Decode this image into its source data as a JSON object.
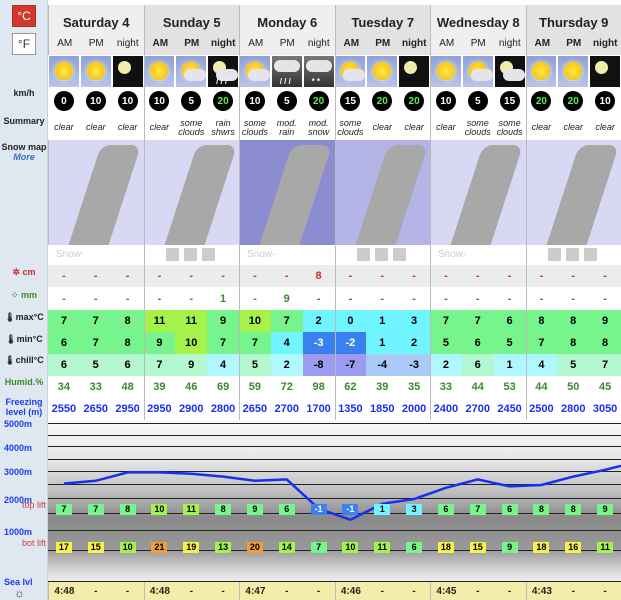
{
  "units": {
    "celsius": "°C",
    "fahrenheit": "°F"
  },
  "labels": {
    "wind": "km/h",
    "summary": "Summary",
    "snow_map": "Snow map",
    "more": "More",
    "snow_cm": "cm",
    "rain_mm": "mm",
    "max": "max°C",
    "min": "min°C",
    "chill": "chill°C",
    "humid": "Humid.%",
    "freezing": "Freezing level (m)",
    "alt5000": "5000m",
    "alt4000": "4000m",
    "alt3000": "3000m",
    "alt2000": "2000m",
    "alt1000": "1000m",
    "sea": "Sea lvl",
    "top_lift": "top lift",
    "bot_lift": "bot lift"
  },
  "days": [
    {
      "name": "Saturday 4"
    },
    {
      "name": "Sunday 5"
    },
    {
      "name": "Monday 6"
    },
    {
      "name": "Tuesday 7"
    },
    {
      "name": "Wednesday 8"
    },
    {
      "name": "Thursday 9"
    }
  ],
  "periods": [
    "AM",
    "PM",
    "night"
  ],
  "map_credit": "Snow-Forecast.com",
  "icons": [
    "sun",
    "sun",
    "moon",
    "sun",
    "sun-cloud",
    "moon-rain",
    "sun-cloud",
    "rain",
    "snow",
    "sun-cloud",
    "sun",
    "moon",
    "sun",
    "sun-cloud",
    "moon-cloud",
    "sun",
    "sun",
    "moon"
  ],
  "wind": [
    "0",
    "10",
    "10",
    "10",
    "5",
    "20",
    "10",
    "5",
    "20",
    "15",
    "20",
    "20",
    "10",
    "5",
    "15",
    "20",
    "20",
    "10"
  ],
  "summary": [
    "clear",
    "clear",
    "clear",
    "clear",
    "some clouds",
    "rain shwrs",
    "some clouds",
    "mod. rain",
    "mod. snow",
    "some clouds",
    "clear",
    "clear",
    "clear",
    "some clouds",
    "some clouds",
    "clear",
    "clear",
    "clear"
  ],
  "snow_cm": [
    "-",
    "-",
    "-",
    "-",
    "-",
    "-",
    "-",
    "-",
    "8",
    "-",
    "-",
    "-",
    "-",
    "-",
    "-",
    "-",
    "-",
    "-"
  ],
  "rain_mm": [
    "-",
    "-",
    "-",
    "-",
    "-",
    "1",
    "-",
    "9",
    "-",
    "-",
    "-",
    "-",
    "-",
    "-",
    "-",
    "-",
    "-",
    "-"
  ],
  "max": [
    "7",
    "7",
    "8",
    "11",
    "11",
    "9",
    "10",
    "7",
    "2",
    "0",
    "1",
    "3",
    "7",
    "7",
    "6",
    "8",
    "8",
    "9"
  ],
  "min": [
    "6",
    "7",
    "8",
    "9",
    "10",
    "7",
    "7",
    "4",
    "-3",
    "-2",
    "1",
    "2",
    "5",
    "6",
    "5",
    "7",
    "8",
    "8"
  ],
  "chill": [
    "6",
    "5",
    "6",
    "7",
    "9",
    "4",
    "5",
    "2",
    "-8",
    "-7",
    "-4",
    "-3",
    "2",
    "6",
    "1",
    "4",
    "5",
    "7"
  ],
  "humid": [
    "34",
    "33",
    "48",
    "39",
    "46",
    "69",
    "59",
    "72",
    "98",
    "62",
    "39",
    "35",
    "33",
    "44",
    "53",
    "44",
    "50",
    "45"
  ],
  "freezing": [
    "2550",
    "2650",
    "2950",
    "2950",
    "2900",
    "2800",
    "2650",
    "2700",
    "1700",
    "1350",
    "1850",
    "2000",
    "2400",
    "2700",
    "2450",
    "2500",
    "2800",
    "3050"
  ],
  "top_lift": [
    "7",
    "7",
    "8",
    "10",
    "11",
    "8",
    "9",
    "6",
    "-1",
    "-1",
    "1",
    "3",
    "6",
    "7",
    "6",
    "8",
    "8",
    "9"
  ],
  "bot_lift": [
    "17",
    "15",
    "10",
    "21",
    "19",
    "13",
    "20",
    "14",
    "7",
    "10",
    "11",
    "6",
    "18",
    "15",
    "9",
    "18",
    "16",
    "11"
  ],
  "sunrise": [
    "4:48",
    "-",
    "-",
    "4:48",
    "-",
    "-",
    "4:47",
    "-",
    "-",
    "4:46",
    "-",
    "-",
    "4:45",
    "-",
    "-",
    "4:43",
    "-",
    "-"
  ],
  "colors": {
    "celsius_active": "#d0392b",
    "freezing_line": "#1a2ff0",
    "snow": "#d03030",
    "rain": "#3a8a2a"
  }
}
